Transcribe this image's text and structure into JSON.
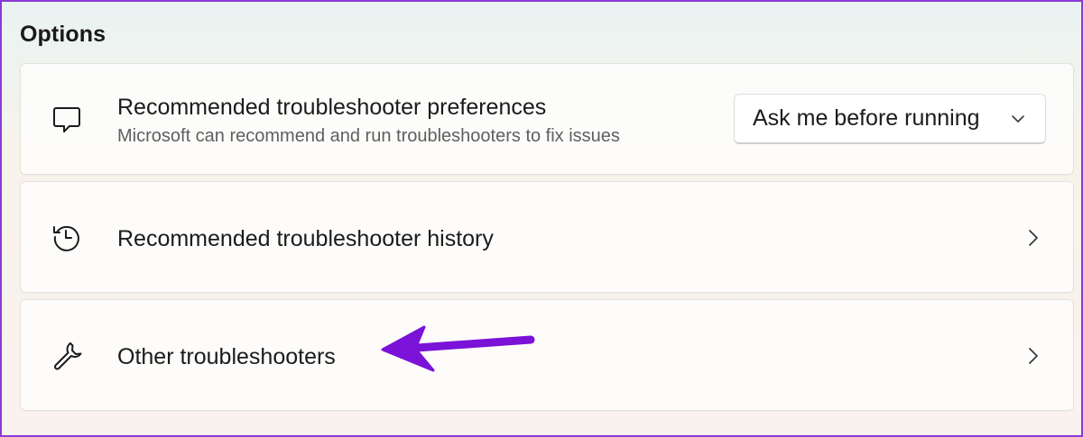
{
  "section": {
    "title": "Options"
  },
  "options": {
    "preferences": {
      "icon": "feedback-message-icon",
      "title": "Recommended troubleshooter preferences",
      "subtitle": "Microsoft can recommend and run troubleshooters to fix issues",
      "dropdown_value": "Ask me before running"
    },
    "history": {
      "icon": "history-clock-icon",
      "title": "Recommended troubleshooter history"
    },
    "other": {
      "icon": "wrench-icon",
      "title": "Other troubleshooters"
    }
  },
  "annotation": {
    "arrow_color": "#7b12d8"
  }
}
